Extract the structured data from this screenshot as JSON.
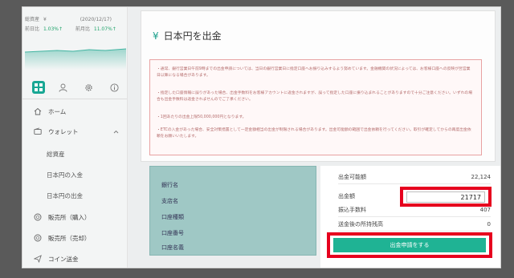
{
  "sidebar": {
    "assets_label": "総資産",
    "assets_currency": "¥",
    "assets_date": "(2020/12/17)",
    "prev_day_label": "前日比",
    "prev_day_value": "1.03%↑",
    "prev_month_label": "前月比",
    "prev_month_value": "11.07%↑",
    "tabs": [
      "grid-icon",
      "user-icon",
      "gear-icon",
      "info-icon"
    ],
    "nav": {
      "home": "ホーム",
      "wallet": "ウォレット",
      "wallet_items": [
        "総資産",
        "日本円の入金",
        "日本円の出金"
      ],
      "buy": "販売所（購入）",
      "sell": "販売所（売却）",
      "coin_send": "コイン送金"
    }
  },
  "main": {
    "title_symbol": "¥",
    "title": "日本円を出金",
    "notices": [
      "・通常、銀行営業日午前9時までの出金申請については、当日の銀行営業日に指定口座へお振り込みするよう努めています。金融機関の状況によっては、お客様口座への反映が翌営業日以降になる場合があります。",
      "・指定した口座情報に誤りがあった場合、出金手数料をお客様アカウントに返金されますが、誤って指定した口座に振り込まれることがありますので十分ご注意ください。いずれの場合も出金手数料は返金されませんのでご了承ください。",
      "・1回あたりの出金上限50,000,000円となります。",
      "・ETCの入金があった場合、安全対策措置として一定金額相当の出金が制限される場合があります。出金可能額の範囲で出金依頼を行ってください。取引が確定してからの再度出金依頼をお願いいたします。"
    ],
    "bank_fields": [
      "銀行名",
      "支店名",
      "口座種類",
      "口座番号",
      "口座名義"
    ],
    "summary": {
      "available_label": "出金可能額",
      "available_value": "22,124",
      "amount_label": "出金額",
      "amount_value": "21717",
      "fee_label": "振込手数料",
      "fee_value": "407",
      "balance_label": "送金後の所持残高",
      "balance_value": "0",
      "submit_label": "出金申請をする"
    }
  },
  "colors": {
    "accent": "#1fb394",
    "highlight": "#e6001e",
    "bank_panel": "#9fc8c5"
  }
}
